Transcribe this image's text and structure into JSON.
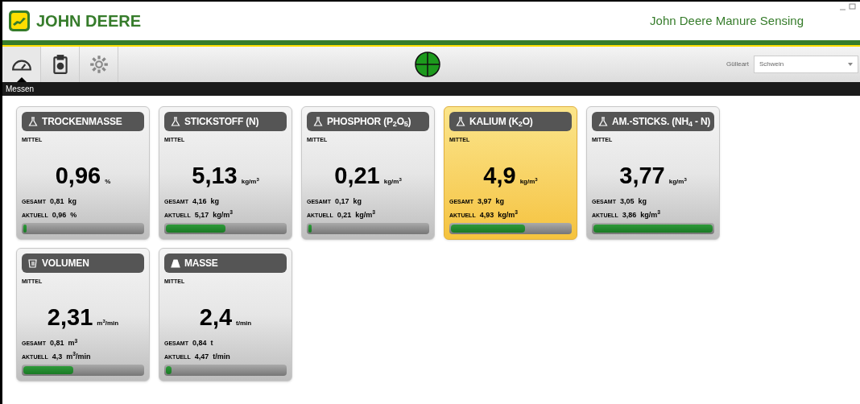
{
  "header": {
    "brand": "JOHN DEERE",
    "app_title": "John Deere Manure Sensing"
  },
  "toolbar": {
    "tools": [
      {
        "kind": "gauge",
        "selected": true
      },
      {
        "kind": "clipboard",
        "selected": false
      },
      {
        "kind": "gear",
        "selected": false
      }
    ],
    "manure_type": {
      "label": "Gülleart",
      "value": "Schwein"
    }
  },
  "section_title": "Messen",
  "cards": [
    {
      "kind": "flask",
      "title": "TROCKENMASSE",
      "mean_label": "MITTEL",
      "value": "0,96",
      "unit": "%",
      "total_label": "GESAMT",
      "total": "0,81",
      "total_unit": "kg",
      "current_label": "AKTUELL",
      "current": "0,96",
      "current_unit": "%",
      "level": 0.03,
      "highlighted": false
    },
    {
      "kind": "flask",
      "title": "STICKSTOFF (N)",
      "mean_label": "MITTEL",
      "value": "5,13",
      "unit": "kg/m$^{3}$",
      "total_label": "GESAMT",
      "total": "4,16",
      "total_unit": "kg",
      "current_label": "AKTUELL",
      "current": "5,17",
      "current_unit": "kg/m$^{3}$",
      "level": 0.5,
      "highlighted": false
    },
    {
      "kind": "flask",
      "title": "PHOSPHOR (P$_{2}$O$_{5}$)",
      "mean_label": "MITTEL",
      "value": "0,21",
      "unit": "kg/m$^{3}$",
      "total_label": "GESAMT",
      "total": "0,17",
      "total_unit": "kg",
      "current_label": "AKTUELL",
      "current": "0,21",
      "current_unit": "kg/m$^{3}$",
      "level": 0.03,
      "highlighted": false
    },
    {
      "kind": "flask",
      "title": "KALIUM (K$_{2}$O)",
      "mean_label": "MITTEL",
      "value": "4,9",
      "unit": "kg/m$^{3}$",
      "total_label": "GESAMT",
      "total": "3,97",
      "total_unit": "kg",
      "current_label": "AKTUELL",
      "current": "4,93",
      "current_unit": "kg/m$^{3}$",
      "level": 0.62,
      "highlighted": true
    },
    {
      "kind": "flask",
      "title": "AM.-STICKS. (NH$_{4}$ - N)",
      "mean_label": "MITTEL",
      "value": "3,77",
      "unit": "kg/m$^{3}$",
      "total_label": "GESAMT",
      "total": "3,05",
      "total_unit": "kg",
      "current_label": "AKTUELL",
      "current": "3,86",
      "current_unit": "kg/m$^{3}$",
      "level": 1.0,
      "highlighted": false
    },
    {
      "kind": "cup",
      "title": "VOLUMEN",
      "mean_label": "MITTEL",
      "value": "2,31",
      "unit": "m$^{3}$/min",
      "total_label": "GESAMT",
      "total": "0,81",
      "total_unit": "m$^{3}$",
      "current_label": "AKTUELL",
      "current": "4,3",
      "current_unit": "m$^{3}$/min",
      "level": 0.42,
      "highlighted": false
    },
    {
      "kind": "weight",
      "title": "MASSE",
      "mean_label": "MITTEL",
      "value": "2,4",
      "unit": "t/min",
      "total_label": "GESAMT",
      "total": "0,84",
      "total_unit": "t",
      "current_label": "AKTUELL",
      "current": "4,47",
      "current_unit": "t/min",
      "level": 0.05,
      "highlighted": false
    }
  ]
}
